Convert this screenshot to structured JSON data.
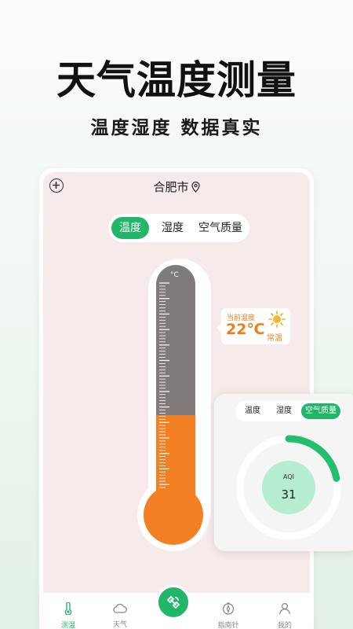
{
  "hero": {
    "title": "天气温度测量",
    "subtitle": "温度湿度 数据真实"
  },
  "header": {
    "city": "合肥市",
    "add_icon": "plus-circle-icon",
    "location_icon": "location-pin-icon"
  },
  "tabs": [
    {
      "label": "温度",
      "active": true
    },
    {
      "label": "湿度",
      "active": false
    },
    {
      "label": "空气质量",
      "active": false
    }
  ],
  "thermometer": {
    "unit": "°C",
    "level": 0.42
  },
  "current": {
    "label": "当前温度",
    "temperature": "22℃",
    "status": "常温",
    "weather_icon": "sun-icon"
  },
  "aqi_panel": {
    "tabs": [
      {
        "label": "温度",
        "active": false
      },
      {
        "label": "湿度",
        "active": false
      },
      {
        "label": "空气质量",
        "active": true
      }
    ],
    "label": "AQI",
    "value": "31",
    "progress": 0.22
  },
  "nav": {
    "items": [
      {
        "label": "测温",
        "icon": "thermometer-icon",
        "active": true
      },
      {
        "label": "天气",
        "icon": "cloud-icon",
        "active": false
      },
      {
        "label": "指南针",
        "icon": "compass-icon",
        "active": false
      },
      {
        "label": "我的",
        "icon": "user-icon",
        "active": false
      }
    ],
    "center_icon": "satellite-icon"
  },
  "colors": {
    "accent": "#22b768",
    "mercury": "#f48024",
    "tube_empty": "#807b7b",
    "screen_bg": "#f6eaea"
  }
}
